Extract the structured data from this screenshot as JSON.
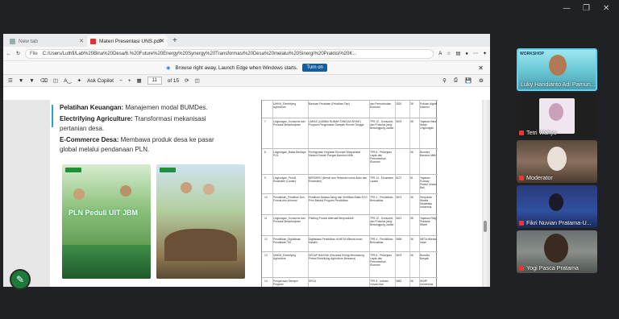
{
  "browser": {
    "tabs": [
      {
        "label": "New tab"
      },
      {
        "label": "Materi Presentasi UNS.pdf"
      }
    ],
    "address": {
      "scheme": "File",
      "url": "C:/Users/Luthfi/Lab%20Bina%20Desa/6.%20Future%20Energy%20Synergy%20Transformasi%20Desa%20melalui%20Sinergi%20Praktisi%20K..."
    },
    "notice": {
      "text": "Browse right away. Launch Edge when Windows starts.",
      "button": "Turn on"
    },
    "pdf_toolbar": {
      "ask_copilot": "Ask Copilot",
      "page_current": "11",
      "page_total": "of 15"
    }
  },
  "slide": {
    "lines": [
      {
        "bold": "Pelatihan Keuangan:",
        "text": " Manajemen modal BUMDes."
      },
      {
        "bold": "Electrifying Agriculture:",
        "text": " Transformasi mekanisasi pertanian desa."
      },
      {
        "bold": "E-Commerce Desa:",
        "text": " Membawa produk desa ke pasar global melalui pendanaan PLN."
      }
    ],
    "photo_caption": "PLN Peduli UIT JBM"
  },
  "table_rows": [
    {
      "no": "",
      "a": "UMKM_Electrifying Agriculture",
      "b": "Bantuan Peralatan (Pelatihan Tani)",
      "c": "dan Pertumbuhan Ekonomi",
      "d": "2520",
      "e": "38",
      "f": "Pokdari Algrati Makmur"
    },
    {
      "no": "7",
      "a": "Lingkungan_Konsumsi dan Produksi Berkelanjutan",
      "b": "LARAS (LAMBAI RUMAH TANGGA SEHAT) Program Pengelolaan Sampah Rumah Tangga",
      "c": "TPB 12 - Konsumsi dan Produksi yang Bertanggung Jawab",
      "d": "3678",
      "e": "38",
      "f": "Yayasan Bina Ilmiah Lingkungan"
    },
    {
      "no": "8",
      "a": "Lingkungan_Batas Berdaya PLN",
      "b": "Peningkatan Kegiatan Ekonomi Masyarakat Melalui Rumah Pangan Bamboo Milik",
      "c": "TPB 8 - Pekerjaan Layak dan Pertumbuhan Ekonomi",
      "d": "",
      "e": "38",
      "f": "Bumdes Bamboo Milik"
    },
    {
      "no": "9",
      "a": "Lingkungan_Pedoli Ekosistem (Lautan)",
      "b": "BERSERU (Bersih dan Restorasi untuk Alam dan Ekosistem)",
      "c": "TPB 14 - Ekosistem Lautan",
      "d": "5107",
      "e": "51",
      "f": "Yayasan Ecoway Pesisir Lestari Bali"
    },
    {
      "no": "10",
      "a": "Pendidikan_Pelatihan Non Formal dan Informal",
      "b": "Pelatihan Bahasa Asing dan Sertifikasi Batik ECO Print Melalui Program Pendidikan",
      "c": "TPB 4 - Pendidikan Berkualitas",
      "d": "3674",
      "e": "36",
      "f": "Himpunan Wanita Disabilitas Indonesia"
    },
    {
      "no": "11",
      "a": "Lingkungan_Konsumsi dan Produksi Berkelanjutan",
      "b": "Pilahing Produk Alternatif Berproduktif",
      "c": "TPB 12 - Konsumsi dan Produksi yang Bertanggung Jawab",
      "d": "3613",
      "e": "36",
      "f": "Yayasan Ridg Pradana Wiwet"
    },
    {
      "no": "12",
      "a": "Pendidikan_Digitalisasi Pendidikan TIK",
      "b": "Digitalisasi Pendidikan di META Milenia Insan Mandiri",
      "c": "TPB 4 - Pendidikan Berkualitas",
      "d": "3598",
      "e": "36",
      "f": "META Milenia Insan"
    },
    {
      "no": "13",
      "a": "UMKM_Electrifying Agriculture",
      "b": "SEDAP BANYAK (Semesta Energi Mendukung Petani Electrifying Agriculture Bersama)",
      "c": "TPB 8 - Pekerjaan Layak dan Pertumbuhan Ekonomi",
      "d": "3678",
      "e": "38",
      "f": "Bumdes Banyak"
    },
    {
      "no": "14",
      "a": "Pengurusan Stempel Program",
      "b": "SRCA",
      "c": "TPB 9 - Industri, Inovasi dan Infrastruktur",
      "d": "3682",
      "e": "38",
      "f": "SKMP Universitas Airlangga"
    }
  ],
  "participants": [
    {
      "name": "Luky Handianto Adi Pamun...",
      "badge": "WORKSHOP"
    },
    {
      "name": "Tetri Wahyu"
    },
    {
      "name": "Moderator"
    },
    {
      "name": "Fikri Nuvian Pratama-U..."
    },
    {
      "name": "Yogi Pasca Pratama"
    }
  ]
}
